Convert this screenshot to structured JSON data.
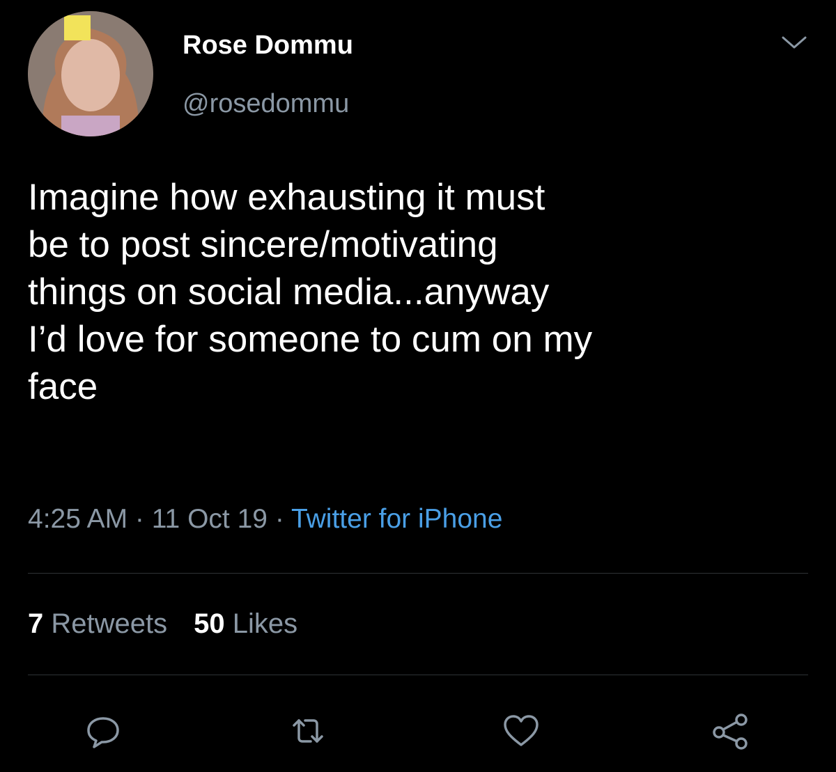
{
  "tweet": {
    "display_name": "Rose Dommu",
    "handle": "@rosedommu",
    "text": "Imagine how exhausting it must\nbe to post sincere/motivating\nthings on social media...anyway\nI’d love for someone to cum on my\nface",
    "time": "4:25 AM",
    "date": "11 Oct 19",
    "separator": " · ",
    "source": "Twitter for iPhone"
  },
  "stats": {
    "retweets_count": "7",
    "retweets_label": "Retweets",
    "likes_count": "50",
    "likes_label": "Likes"
  },
  "icons": {
    "menu": "chevron-down-icon",
    "reply": "reply-icon",
    "retweet": "retweet-icon",
    "like": "heart-icon",
    "share": "share-icon"
  },
  "colors": {
    "background": "#000000",
    "text": "#ffffff",
    "secondary_text": "#8b98a5",
    "link": "#4a9fe6",
    "divider": "#2f3336"
  }
}
